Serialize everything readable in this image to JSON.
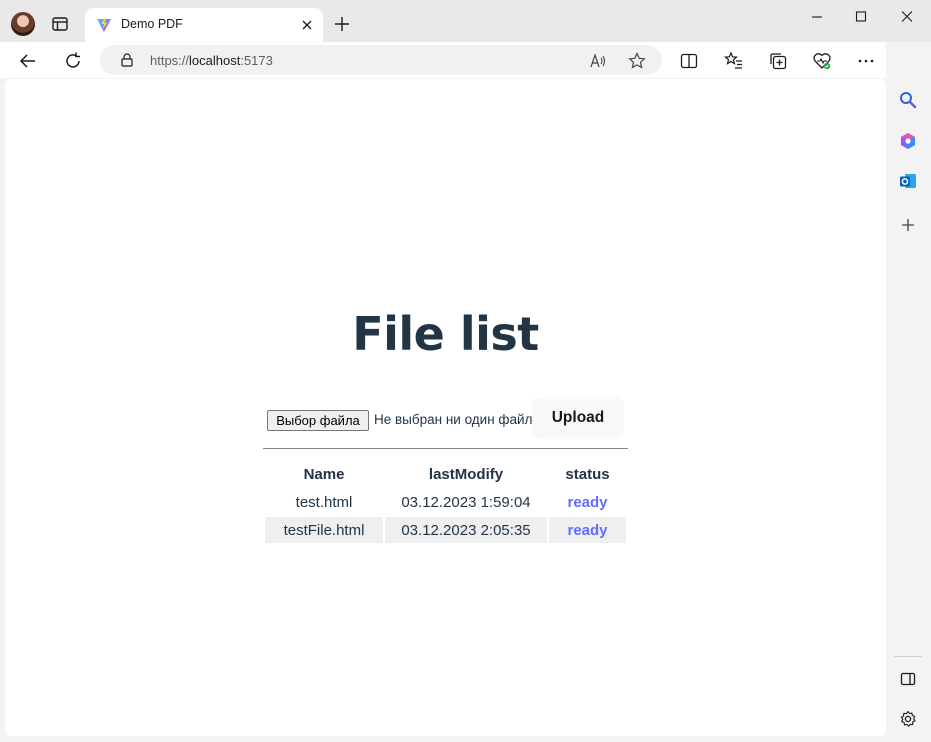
{
  "browser": {
    "tab_title": "Demo PDF",
    "url_prefix": "https://",
    "url_host": "localhost",
    "url_port": ":5173"
  },
  "page": {
    "title": "File list",
    "file_input_button": "Выбор файла",
    "file_input_status": "Не выбран ни один файл",
    "upload_button": "Upload"
  },
  "table": {
    "headers": [
      "Name",
      "lastModify",
      "status"
    ],
    "rows": [
      {
        "name": "test.html",
        "last_modify": "03.12.2023 1:59:04",
        "status": "ready"
      },
      {
        "name": "testFile.html",
        "last_modify": "03.12.2023 2:05:35",
        "status": "ready"
      }
    ]
  },
  "colors": {
    "heading": "#213547",
    "status_link": "#646cff",
    "row_stripe": "#efefef"
  },
  "icons": {
    "tab_strip": [
      "profile-avatar",
      "tab-actions-icon",
      "vite-favicon",
      "close-tab-icon",
      "new-tab-icon"
    ],
    "window": [
      "minimize-icon",
      "maximize-icon",
      "close-window-icon"
    ],
    "toolbar": [
      "back-icon",
      "refresh-icon",
      "lock-icon",
      "read-aloud-icon",
      "favorite-star-icon",
      "split-screen-icon",
      "favorites-icon",
      "collections-icon",
      "browser-essentials-icon",
      "more-icon",
      "copilot-icon"
    ],
    "sidebar": [
      "search-icon",
      "microsoft365-icon",
      "outlook-icon",
      "add-icon",
      "hide-sidebar-icon",
      "settings-icon"
    ]
  }
}
